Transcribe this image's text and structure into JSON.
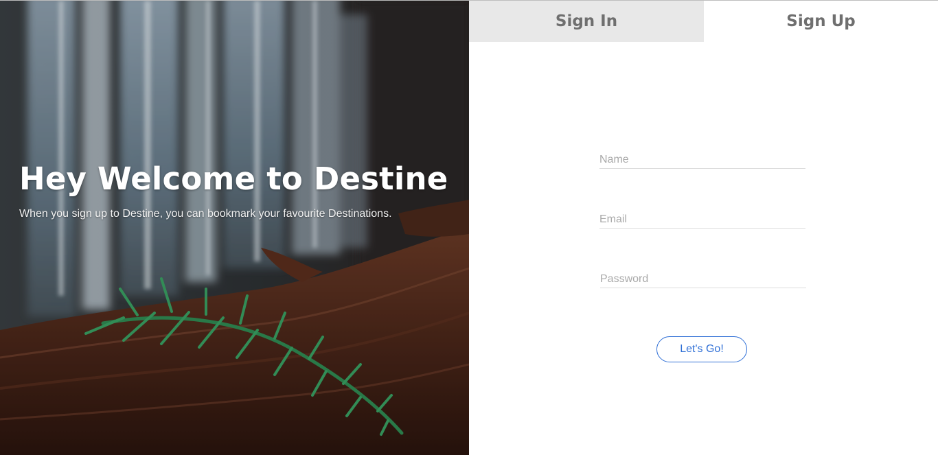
{
  "hero": {
    "title": "Hey Welcome to Destine",
    "subtitle": "When you sign up to Destine, you can bookmark your favourite Destinations."
  },
  "tabs": [
    {
      "label": "Sign In",
      "active": false
    },
    {
      "label": "Sign Up",
      "active": true
    }
  ],
  "form": {
    "name": {
      "placeholder": "Name",
      "value": ""
    },
    "email": {
      "placeholder": "Email",
      "value": ""
    },
    "password": {
      "placeholder": "Password",
      "value": ""
    },
    "submit_label": "Let's Go!"
  },
  "colors": {
    "accent": "#2f6fd6",
    "tab_inactive_bg": "#e8e8e8",
    "tab_text": "#6f6f6f"
  }
}
